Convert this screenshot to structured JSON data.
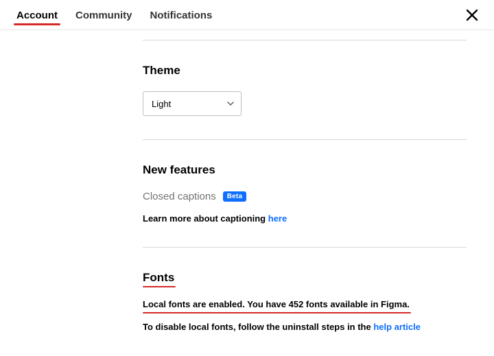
{
  "tabs": {
    "account": "Account",
    "community": "Community",
    "notifications": "Notifications"
  },
  "theme": {
    "title": "Theme",
    "value": "Light"
  },
  "newfeatures": {
    "title": "New features",
    "caption_label": "Closed captions",
    "badge": "Beta",
    "learn_more_pre": "Learn more about captioning ",
    "learn_more_link": "here"
  },
  "fonts": {
    "title": "Fonts",
    "status": "Local fonts are enabled. You have 452 fonts available in Figma.",
    "disable_pre": "To disable local fonts, follow the uninstall steps in the ",
    "disable_link": "help article"
  }
}
